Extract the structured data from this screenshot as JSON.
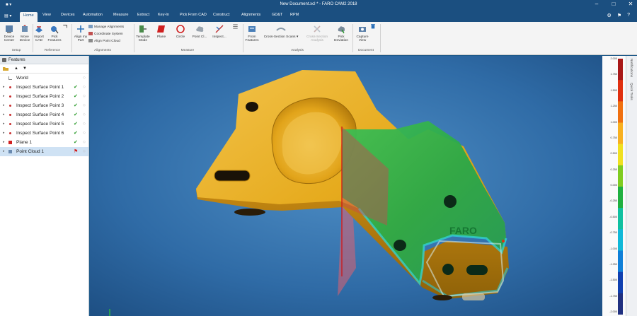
{
  "window": {
    "title": "New Document.xcl * - FARO CAM2 2018",
    "quick_access": "■  ▾",
    "minimize": "–",
    "maximize": "□",
    "close": "✕"
  },
  "menu": {
    "app_menu": "▤ ▾",
    "tabs": [
      "Home",
      "View",
      "Devices",
      "Automation",
      "Measure",
      "Extract",
      "Key-In",
      "Pick From CAD",
      "Construct",
      "Alignments",
      "GD&T",
      "RPM"
    ],
    "active_tab": "Home"
  },
  "ribbon": {
    "setup": {
      "label": "Setup",
      "device_center": "Device Center",
      "move_device": "Move Device"
    },
    "reference": {
      "label": "Reference",
      "import_cad": "Import CAD",
      "pick_features": "Pick Features"
    },
    "alignments": {
      "label": "Alignments",
      "align_my_part": "Align my Part",
      "manage_alignments": "Manage Alignments",
      "coordinate_system": "Coordinate System",
      "align_point_cloud": "Align Point Cloud"
    },
    "measure": {
      "label": "Measure",
      "template_mode": "Template Mode",
      "plane": "Plane",
      "circle": "Circle",
      "point_cloud": "Point Cl...",
      "inspect": "Inspect..."
    },
    "analysis": {
      "label": "Analysis",
      "from_features": "From Features",
      "cross_section_scans": "Cross-Section Scans",
      "cross_section_analysis": "Cross-Section Analysis",
      "pick_deviation": "Pick Deviation"
    },
    "document": {
      "label": "Document",
      "capture_view": "Capture View"
    }
  },
  "features_panel": {
    "title": "Features",
    "tool_up": "▲",
    "tool_down": "▼",
    "items": [
      {
        "label": "World",
        "checked": false,
        "selected": false,
        "icon": "world-icon"
      },
      {
        "label": "Inspect Surface Point 1",
        "checked": true,
        "selected": false,
        "icon": "point-icon"
      },
      {
        "label": "Inspect Surface Point 2",
        "checked": true,
        "selected": false,
        "icon": "point-icon"
      },
      {
        "label": "Inspect Surface Point 3",
        "checked": true,
        "selected": false,
        "icon": "point-icon"
      },
      {
        "label": "Inspect Surface Point 4",
        "checked": true,
        "selected": false,
        "icon": "point-icon"
      },
      {
        "label": "Inspect Surface Point 5",
        "checked": true,
        "selected": false,
        "icon": "point-icon"
      },
      {
        "label": "Inspect Surface Point 6",
        "checked": true,
        "selected": false,
        "icon": "point-icon"
      },
      {
        "label": "Plane 1",
        "checked": true,
        "selected": false,
        "icon": "plane-icon"
      },
      {
        "label": "Point Cloud 1",
        "checked": false,
        "selected": true,
        "icon": "point-cloud-icon"
      }
    ]
  },
  "viewport": {
    "part_marking": "FARO"
  },
  "color_scale": {
    "ticks": [
      "2.000",
      "1.750",
      "1.500",
      "1.250",
      "1.000",
      "0.750",
      "0.500",
      "0.250",
      "0.000",
      "-0.250",
      "-0.500",
      "-0.750",
      "-1.000",
      "-1.250",
      "-1.500",
      "-1.750",
      "-2.000"
    ],
    "colors": [
      "#a81818",
      "#e03010",
      "#f07010",
      "#f8b020",
      "#f0e020",
      "#80cc20",
      "#20b040",
      "#10c0a0",
      "#10b8d8",
      "#1080d8",
      "#1040b0",
      "#203080"
    ]
  },
  "side_tabs": [
    "Notifications",
    "Quick Tools"
  ]
}
